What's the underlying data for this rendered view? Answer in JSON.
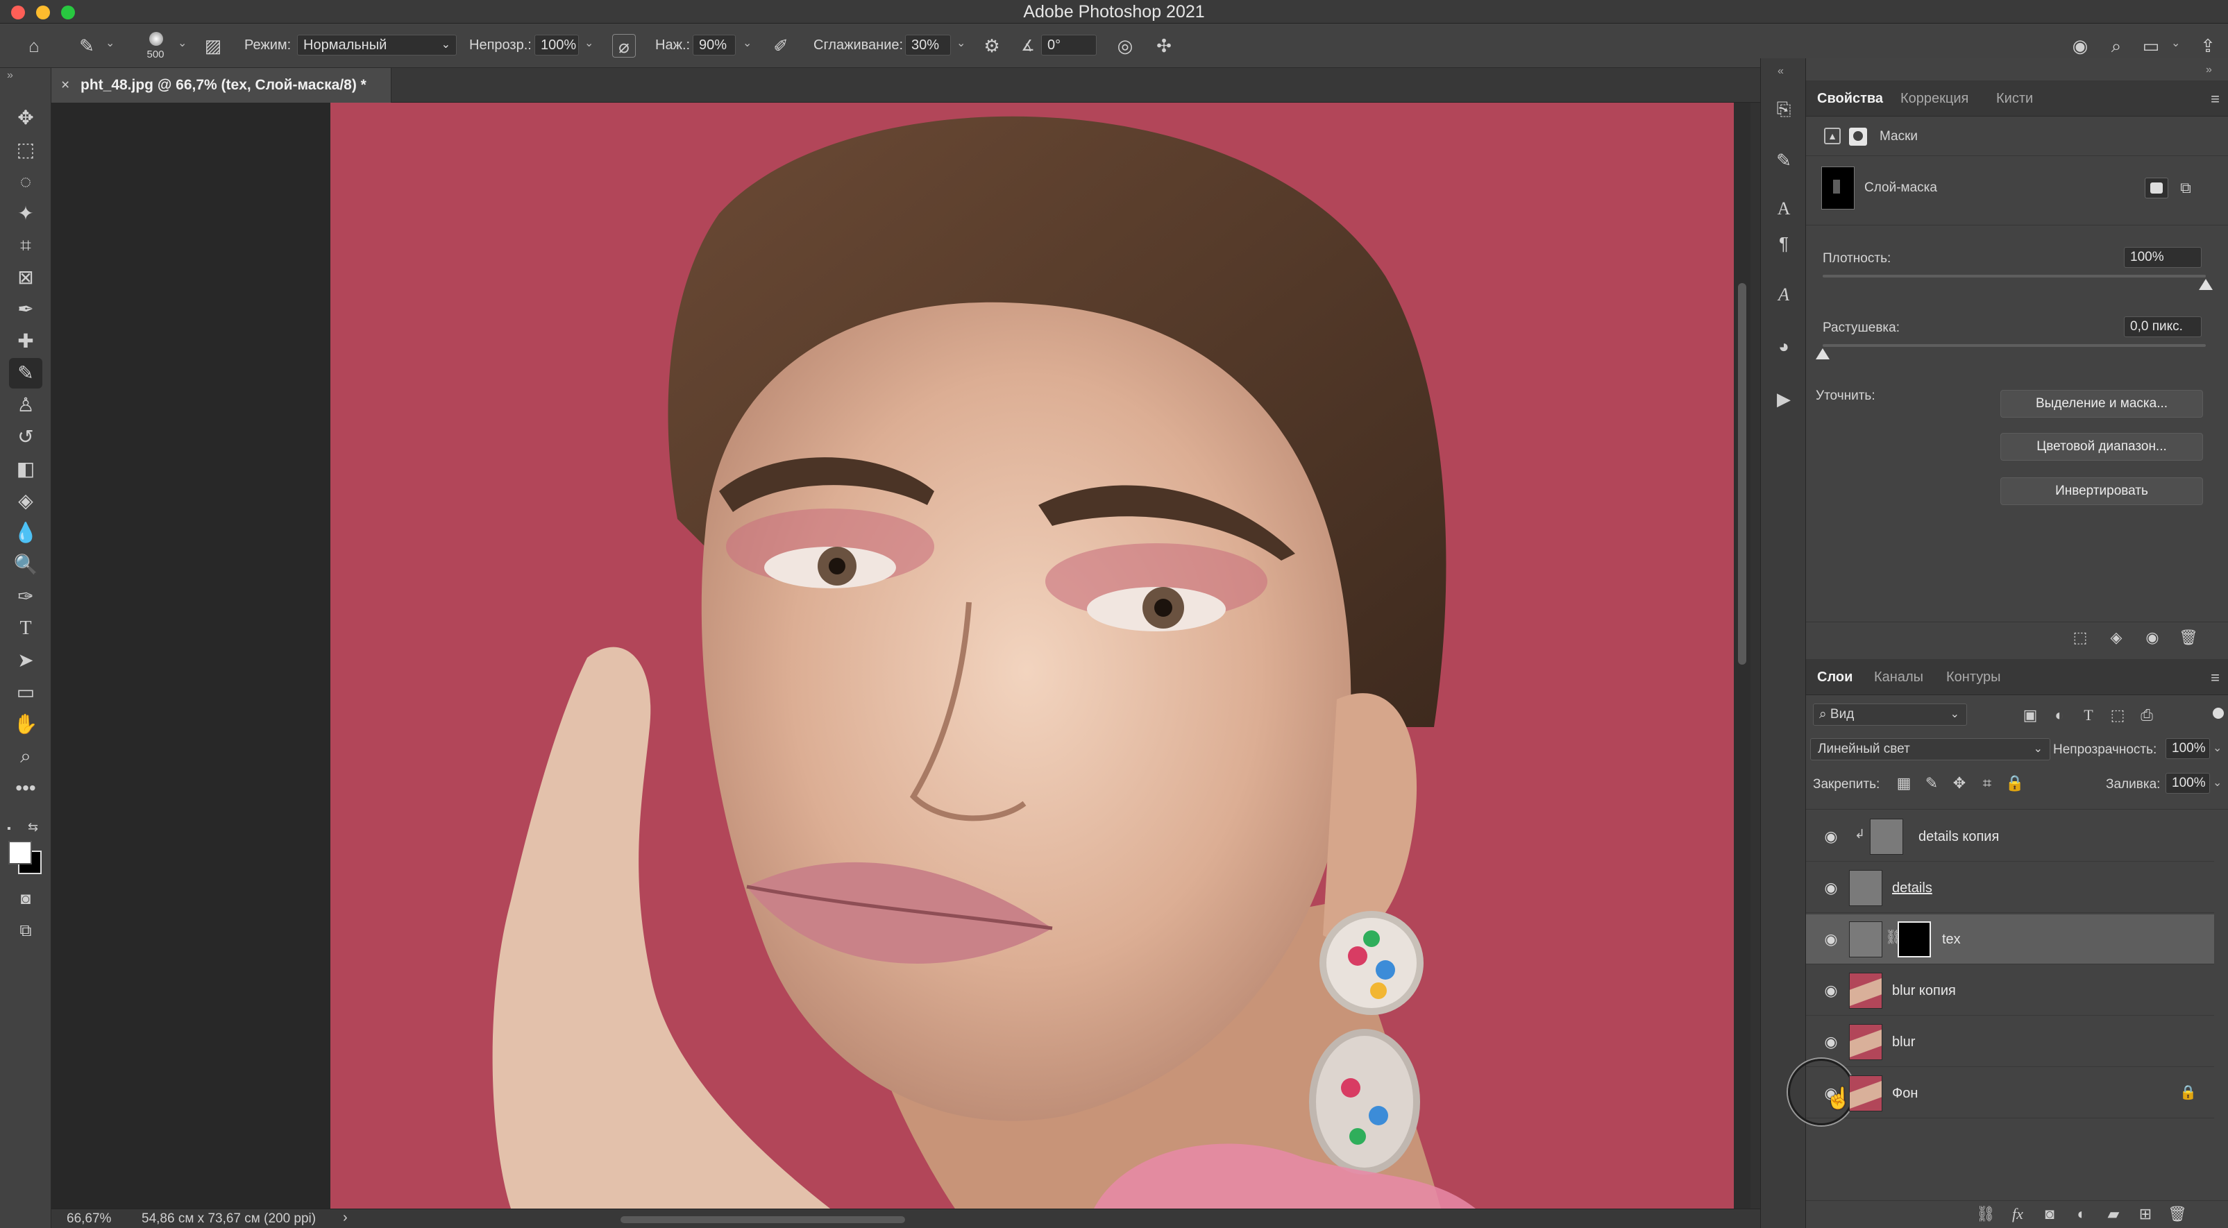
{
  "app": {
    "title": "Adobe Photoshop 2021"
  },
  "options_bar": {
    "brush_size": "500",
    "mode_label": "Режим:",
    "mode_value": "Нормальный",
    "opacity_label": "Непрозр.:",
    "opacity_value": "100%",
    "flow_label": "Наж.:",
    "flow_value": "90%",
    "smoothing_label": "Сглаживание:",
    "smoothing_value": "30%",
    "angle_value": "0°"
  },
  "document": {
    "tab_title": "pht_48.jpg @ 66,7% (tex, Слой-маска/8) *",
    "zoom": "66,67%",
    "doc_info": "54,86 см x 73,67 см (200 ppi)"
  },
  "properties_panel": {
    "tabs": [
      "Свойства",
      "Коррекция",
      "Кисти"
    ],
    "section": "Маски",
    "mask_type": "Слой-маска",
    "density_label": "Плотность:",
    "density_value": "100%",
    "density_level": 1.0,
    "feather_label": "Растушевка:",
    "feather_value": "0,0 пикс.",
    "feather_level": 0.0,
    "refine_label": "Уточнить:",
    "buttons": [
      "Выделение и маска...",
      "Цветовой диапазон...",
      "Инвертировать"
    ]
  },
  "layers_panel": {
    "tabs": [
      "Слои",
      "Каналы",
      "Контуры"
    ],
    "filter_value": "Вид",
    "blend_mode": "Линейный свет",
    "opacity_label": "Непрозрачность:",
    "opacity_value": "100%",
    "lock_label": "Закрепить:",
    "fill_label": "Заливка:",
    "fill_value": "100%",
    "layers": [
      {
        "name": "details копия",
        "visible": true,
        "clipped": true
      },
      {
        "name": "details",
        "visible": true
      },
      {
        "name": "tex",
        "visible": true,
        "selected": true,
        "has_mask": true
      },
      {
        "name": "blur копия",
        "visible": true
      },
      {
        "name": "blur",
        "visible": true
      },
      {
        "name": "Фон",
        "visible": true,
        "locked": true
      }
    ]
  },
  "colors": {
    "backdrop": "#b24659",
    "ui_bg": "#434343",
    "selected_layer": "#5e5e5e"
  }
}
